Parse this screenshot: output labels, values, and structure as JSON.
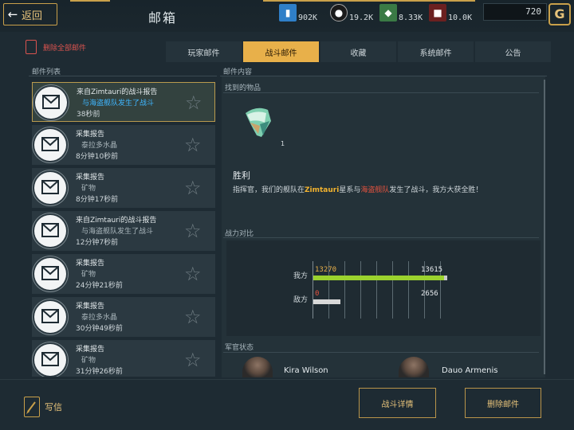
{
  "header": {
    "back_label": "返回",
    "title": "邮箱",
    "resources": [
      {
        "icon": "card-icon",
        "value": "902K",
        "color": "#2f7fc8"
      },
      {
        "icon": "helmet-icon",
        "value": "19.2K",
        "color": "#1b1b1b"
      },
      {
        "icon": "crystal-icon",
        "value": "8.33K",
        "color": "#3a7a45"
      },
      {
        "icon": "ore-icon",
        "value": "10.0K",
        "color": "#6b2020"
      }
    ],
    "currency_value": "720",
    "logo_icon": "g-logo-icon"
  },
  "actions": {
    "delete_all_label": "删除全部邮件"
  },
  "tabs": [
    {
      "label": "玩家邮件",
      "active": false
    },
    {
      "label": "战斗邮件",
      "active": true
    },
    {
      "label": "收藏",
      "active": false
    },
    {
      "label": "系统邮件",
      "active": false
    },
    {
      "label": "公告",
      "active": false
    }
  ],
  "mail_list": {
    "title": "邮件列表",
    "items": [
      {
        "line1": "来自Zimtauri的战斗报告",
        "line2": "与海盗舰队发生了战斗",
        "time": "38秒前",
        "selected": true
      },
      {
        "line1": "采集报告",
        "line2": "泰拉多水晶",
        "time": "8分钟10秒前",
        "selected": false
      },
      {
        "line1": "采集报告",
        "line2": "矿物",
        "time": "8分钟17秒前",
        "selected": false
      },
      {
        "line1": "来自Zimtauri的战斗报告",
        "line2": "与海盗舰队发生了战斗",
        "time": "12分钟7秒前",
        "selected": false
      },
      {
        "line1": "采集报告",
        "line2": "矿物",
        "time": "24分钟21秒前",
        "selected": false
      },
      {
        "line1": "采集报告",
        "line2": "泰拉多水晶",
        "time": "30分钟49秒前",
        "selected": false
      },
      {
        "line1": "采集报告",
        "line2": "矿物",
        "time": "31分钟26秒前",
        "selected": false
      }
    ]
  },
  "detail": {
    "title": "邮件内容",
    "found_items_label": "找到的物品",
    "found_item_count": "1",
    "result": "胜利",
    "desc_parts": [
      "指挥官，我们的舰队在",
      "Zimtauri",
      "星系与",
      "海盗舰队",
      "发生了战斗，我方大获全胜！"
    ],
    "comparison_label": "战力对比",
    "ours_label": "我方",
    "enemy_label": "敌方",
    "ours_value": "13270",
    "ours_max": "13615",
    "enemy_value": "0",
    "enemy_max": "2656",
    "ours_fraction": 0.975,
    "enemy_fraction": 0.2,
    "officers_label": "军官状态",
    "officers": [
      "Kira Wilson",
      "Dauo Armenis"
    ]
  },
  "footer": {
    "write_label": "写信",
    "battle_detail_label": "战斗详情",
    "delete_label": "删除邮件"
  },
  "colors": {
    "accent": "#e8b04a",
    "ours_bar": "#9bd22e",
    "enemy_bar": "#d8d8d8"
  }
}
